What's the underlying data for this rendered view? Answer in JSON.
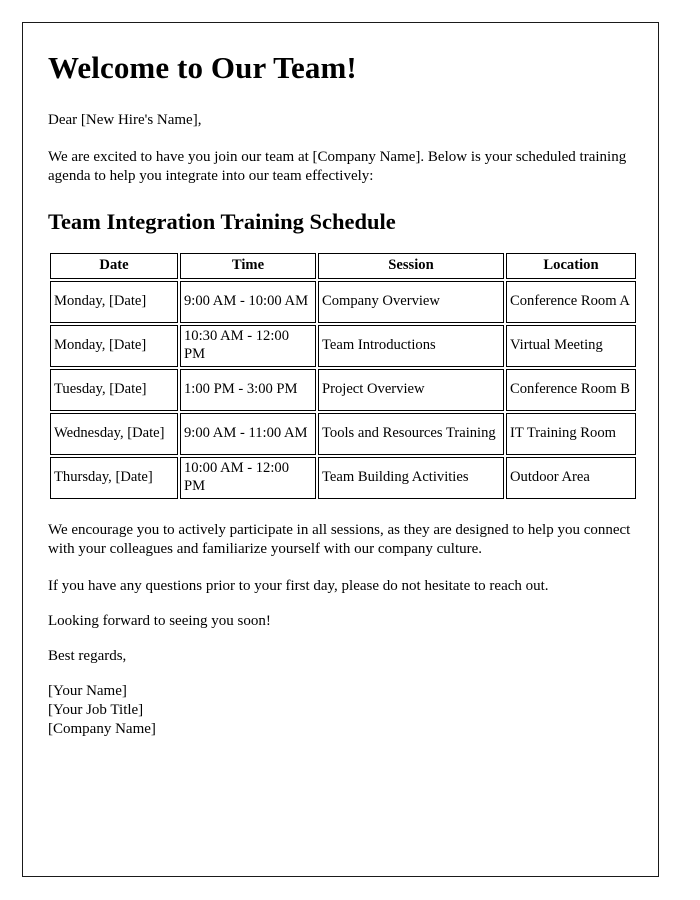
{
  "document": {
    "title": "Welcome to Our Team!",
    "salutation": "Dear [New Hire's Name],",
    "intro_paragraph": "We are excited to have you join our team at [Company Name]. Below is your scheduled training agenda to help you integrate into our team effectively:",
    "section_heading": "Team Integration Training Schedule",
    "encouragement_paragraph": "We encourage you to actively participate in all sessions, as they are designed to help you connect with your colleagues and familiarize yourself with our company culture.",
    "questions_paragraph": "If you have any questions prior to your first day, please do not hesitate to reach out.",
    "closing_line": "Looking forward to seeing you soon!",
    "sign_off": "Best regards,",
    "signature": {
      "name": "[Your Name]",
      "job_title": "[Your Job Title]",
      "company": "[Company Name]"
    }
  },
  "schedule_table": {
    "headers": [
      "Date",
      "Time",
      "Session",
      "Location"
    ],
    "rows": [
      {
        "date": "Monday, [Date]",
        "time": "9:00 AM - 10:00 AM",
        "session": "Company Overview",
        "location": "Conference Room A"
      },
      {
        "date": "Monday, [Date]",
        "time": "10:30 AM - 12:00 PM",
        "session": "Team Introductions",
        "location": "Virtual Meeting"
      },
      {
        "date": "Tuesday, [Date]",
        "time": "1:00 PM - 3:00 PM",
        "session": "Project Overview",
        "location": "Conference Room B"
      },
      {
        "date": "Wednesday, [Date]",
        "time": "9:00 AM - 11:00 AM",
        "session": "Tools and Resources Training",
        "location": "IT Training Room"
      },
      {
        "date": "Thursday, [Date]",
        "time": "10:00 AM - 12:00 PM",
        "session": "Team Building Activities",
        "location": "Outdoor Area"
      }
    ]
  },
  "colors": {
    "text": "#000000",
    "page_border": "#1a1a1a",
    "table_border": "#000000",
    "background": "#ffffff"
  }
}
